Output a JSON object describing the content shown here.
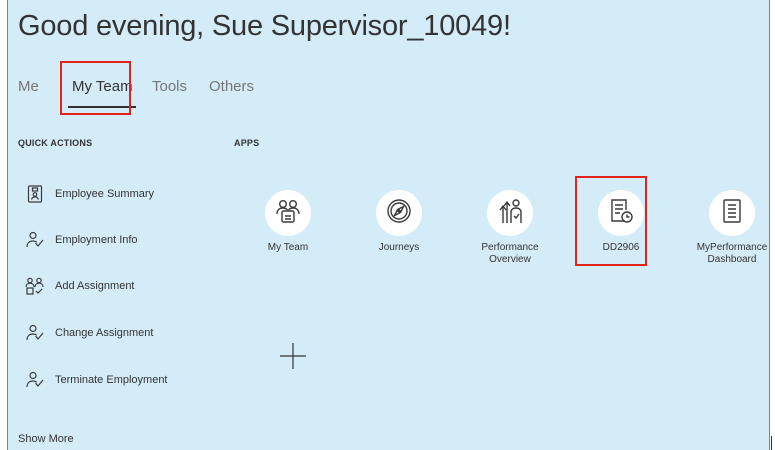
{
  "header": {
    "greeting": "Good evening, Sue Supervisor_10049!"
  },
  "tabs": [
    {
      "label": "Me"
    },
    {
      "label": "My Team"
    },
    {
      "label": "Tools"
    },
    {
      "label": "Others"
    }
  ],
  "quick_actions": {
    "title": "QUICK ACTIONS",
    "items": [
      {
        "label": "Employee Summary",
        "icon": "id-card-icon"
      },
      {
        "label": "Employment Info",
        "icon": "person-check-icon"
      },
      {
        "label": "Add Assignment",
        "icon": "people-add-icon"
      },
      {
        "label": "Change Assignment",
        "icon": "person-check-icon"
      },
      {
        "label": "Terminate Employment",
        "icon": "person-check-icon"
      }
    ],
    "show_more": "Show More"
  },
  "apps": {
    "title": "APPS",
    "items": [
      {
        "label": "My Team",
        "icon": "team-icon"
      },
      {
        "label": "Journeys",
        "icon": "compass-icon"
      },
      {
        "label": "Performance Overview",
        "icon": "performance-icon"
      },
      {
        "label": "DD2906",
        "icon": "document-clock-icon"
      },
      {
        "label": "MyPerformance Dashboard",
        "icon": "document-list-icon"
      }
    ]
  },
  "colors": {
    "panel_bg": "#d4ecf7",
    "highlight": "#e2231a",
    "icon_stroke": "#3a3a3a"
  }
}
